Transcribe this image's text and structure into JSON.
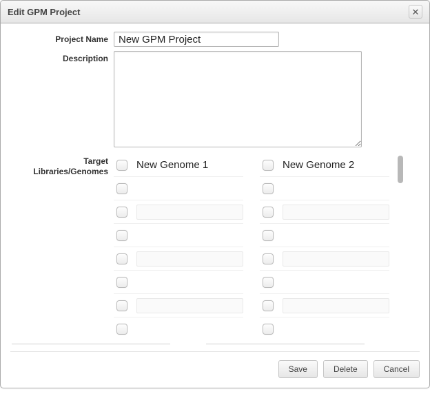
{
  "dialog": {
    "title": "Edit GPM Project",
    "close_icon": "✕"
  },
  "labels": {
    "project_name": "Project Name",
    "description": "Description",
    "targets_line1": "Target",
    "targets_line2": "Libraries/Genomes"
  },
  "fields": {
    "project_name_value": "New GPM Project",
    "description_value": ""
  },
  "targets": {
    "col1": [
      {
        "label": "New Genome 1"
      },
      {
        "label": ""
      },
      {
        "label": ""
      },
      {
        "label": ""
      },
      {
        "label": ""
      },
      {
        "label": ""
      },
      {
        "label": ""
      },
      {
        "label": ""
      }
    ],
    "col2": [
      {
        "label": "New Genome 2"
      },
      {
        "label": ""
      },
      {
        "label": ""
      },
      {
        "label": ""
      },
      {
        "label": ""
      },
      {
        "label": ""
      },
      {
        "label": ""
      },
      {
        "label": ""
      }
    ]
  },
  "buttons": {
    "save": "Save",
    "delete": "Delete",
    "cancel": "Cancel"
  }
}
